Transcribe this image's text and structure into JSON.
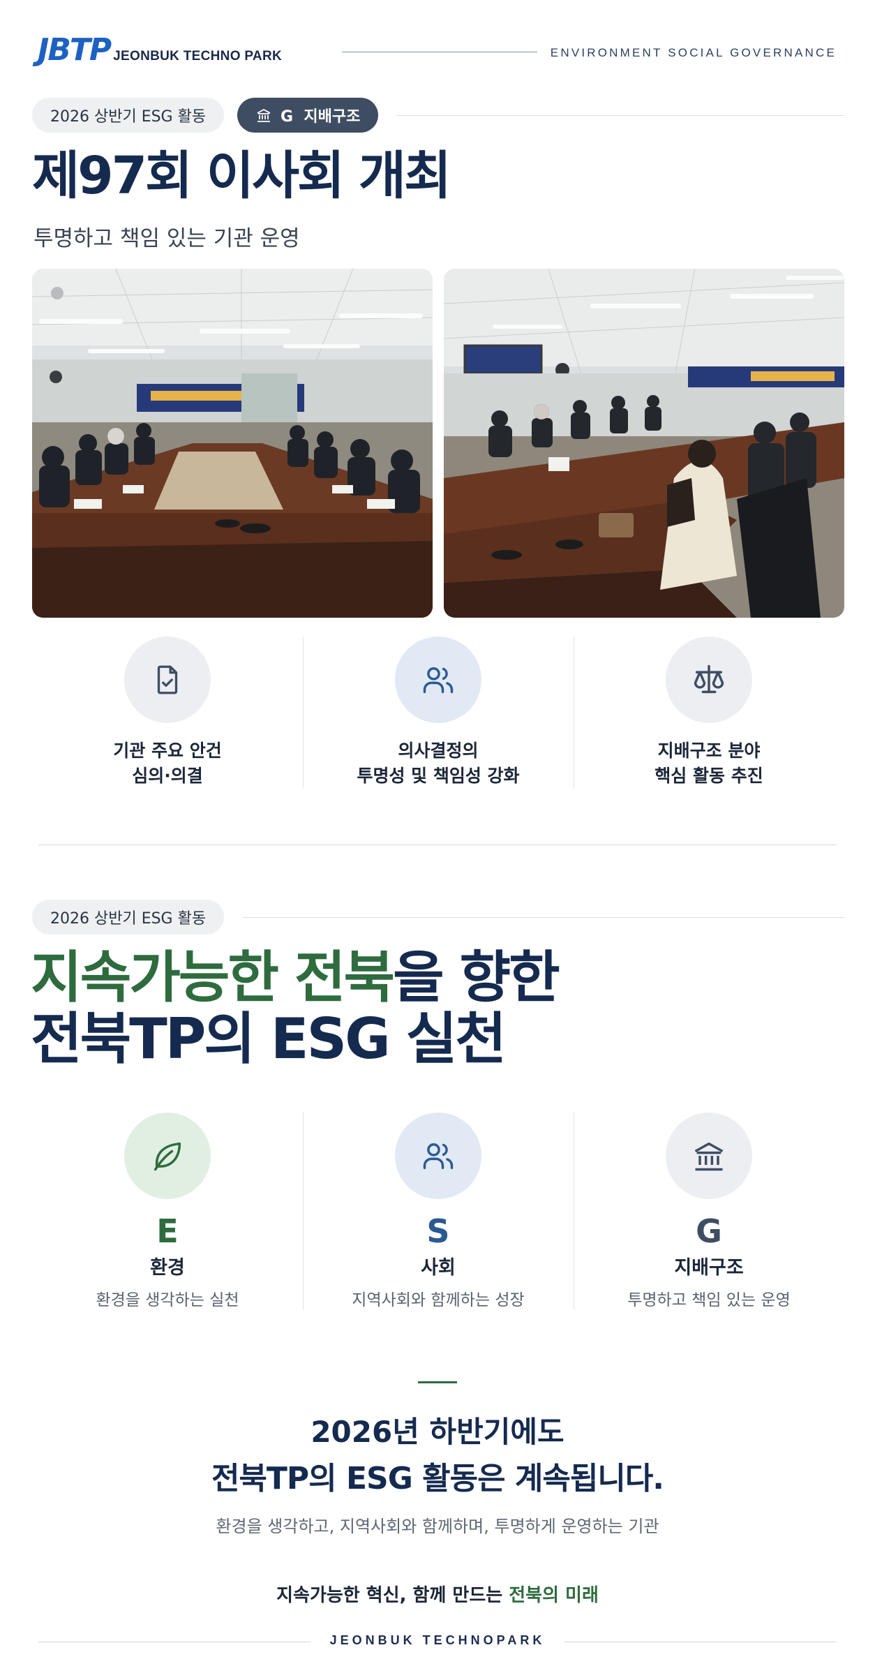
{
  "header": {
    "logo_mark": "JBTP",
    "logo_text": "JEONBUK TECHNO PARK",
    "tagline": "ENVIRONMENT SOCIAL GOVERNANCE"
  },
  "section1": {
    "period_pill": "2026 상반기 ESG 활동",
    "category_pill": "G  지배구조",
    "category_icon": "institution-icon",
    "title": "제97회 이사회 개최",
    "subtitle": "투명하고 책임 있는 기관 운영",
    "photos": [
      {
        "alt": "board meeting room photo 1"
      },
      {
        "alt": "board meeting room photo 2"
      }
    ],
    "features": [
      {
        "icon": "document-check-icon",
        "label": "기관 주요 안건\n심의·의결"
      },
      {
        "icon": "users-icon",
        "label": "의사결정의\n투명성 및 책임성 강화"
      },
      {
        "icon": "scale-icon",
        "label": "지배구조 분야\n핵심 활동 추진"
      }
    ]
  },
  "section2": {
    "period_pill": "2026 상반기 ESG 활동",
    "headline_green": "지속가능한 전북",
    "headline_rest": "을 향한",
    "headline_line2": "전북TP의 ESG 실천",
    "pillars": [
      {
        "icon": "leaf-icon",
        "letter": "E",
        "name": "환경",
        "desc": "환경을 생각하는 실천",
        "color": "#2e6b3e"
      },
      {
        "icon": "users-icon",
        "letter": "S",
        "name": "사회",
        "desc": "지역사회와 함께하는 성장",
        "color": "#2b5a93"
      },
      {
        "icon": "institution-icon",
        "letter": "G",
        "name": "지배구조",
        "desc": "투명하고 책임 있는 운영",
        "color": "#3f4d63"
      }
    ]
  },
  "closing": {
    "line1": "2026년 하반기에도",
    "line2": "전북TP의 ESG 활동은 계속됩니다.",
    "sub": "환경을 생각하고, 지역사회와 함께하며, 투명하게 운영하는 기관",
    "tag_dark": "지속가능한 혁신, 함께 만드는 ",
    "tag_green": "전북의 미래"
  },
  "footer": {
    "text": "JEONBUK TECHNOPARK"
  },
  "colors": {
    "navy": "#152a4f",
    "green": "#2e6b3e",
    "blue": "#2b5a93",
    "slate": "#3f4d63"
  }
}
